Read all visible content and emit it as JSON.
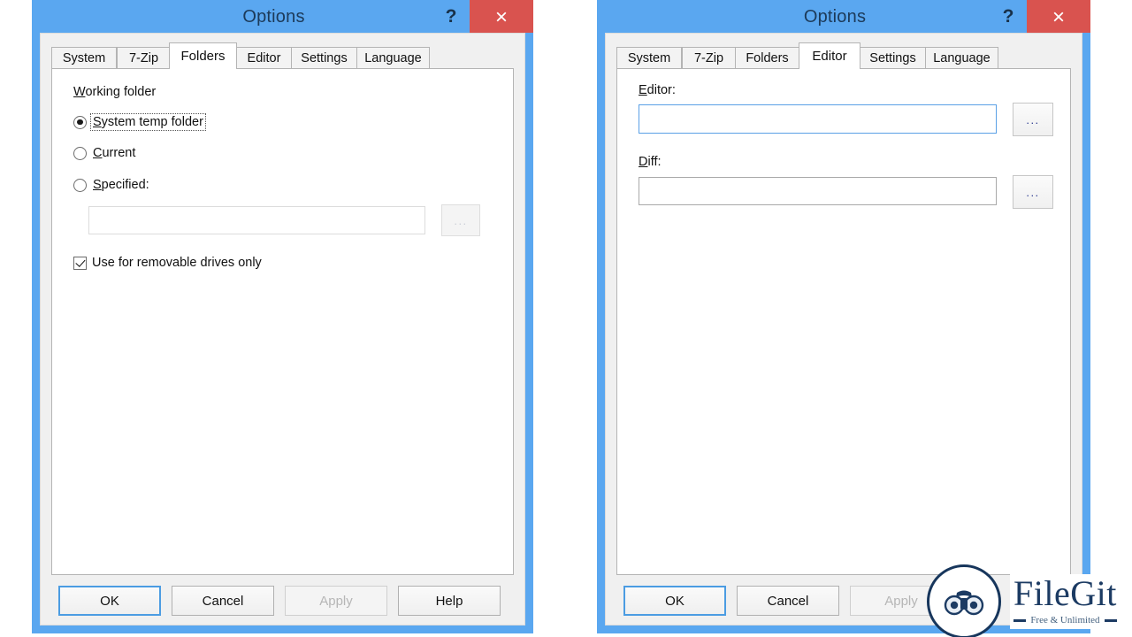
{
  "windows": {
    "left": {
      "title": "Options",
      "help_icon": "?",
      "close_icon": "close-icon",
      "tabs": [
        {
          "label": "System",
          "selected": false
        },
        {
          "label": "7-Zip",
          "selected": false
        },
        {
          "label": "Folders",
          "selected": true
        },
        {
          "label": "Editor",
          "selected": false
        },
        {
          "label": "Settings",
          "selected": false
        },
        {
          "label": "Language",
          "selected": false
        }
      ],
      "folders_tab": {
        "group_label": "Working folder",
        "radios": [
          {
            "label": "System temp folder",
            "checked": true,
            "focused": true
          },
          {
            "label": "Current",
            "checked": false,
            "focused": false
          },
          {
            "label": "Specified:",
            "checked": false,
            "focused": false
          }
        ],
        "specified_path": "",
        "browse_label": "...",
        "checkbox": {
          "label": "Use for removable drives only",
          "checked": true
        }
      },
      "buttons": [
        {
          "label": "OK",
          "state": "default"
        },
        {
          "label": "Cancel",
          "state": "normal"
        },
        {
          "label": "Apply",
          "state": "disabled"
        },
        {
          "label": "Help",
          "state": "normal"
        }
      ]
    },
    "right": {
      "title": "Options",
      "help_icon": "?",
      "close_icon": "close-icon",
      "tabs": [
        {
          "label": "System",
          "selected": false
        },
        {
          "label": "7-Zip",
          "selected": false
        },
        {
          "label": "Folders",
          "selected": false
        },
        {
          "label": "Editor",
          "selected": true
        },
        {
          "label": "Settings",
          "selected": false
        },
        {
          "label": "Language",
          "selected": false
        }
      ],
      "editor_tab": {
        "editor_label": "Editor:",
        "editor_value": "",
        "editor_browse_label": "...",
        "diff_label": "Diff:",
        "diff_value": "",
        "diff_browse_label": "..."
      },
      "buttons": [
        {
          "label": "OK",
          "state": "default"
        },
        {
          "label": "Cancel",
          "state": "normal"
        },
        {
          "label": "Apply",
          "state": "disabled"
        }
      ]
    }
  },
  "watermark": {
    "name": "FileGit",
    "tagline": "Free & Unlimited",
    "fragment": "Apply"
  },
  "colors": {
    "window_frame": "#5aa7f0",
    "close_button": "#d9534f",
    "title_text": "#1c3a59",
    "focus_border": "#4b9ce2",
    "watermark_navy": "#1c3b63"
  }
}
